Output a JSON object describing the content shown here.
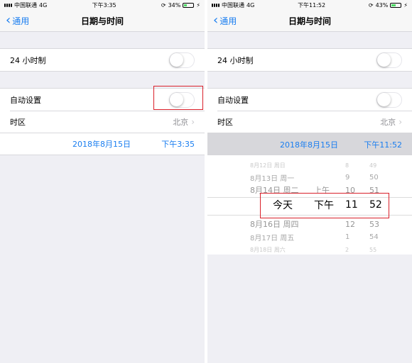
{
  "left": {
    "status": {
      "carrier": "中国联通",
      "network": "4G",
      "time": "下午3:35",
      "battery": "34%",
      "battery_level": 0.34
    },
    "nav": {
      "back_label": "通用",
      "title": "日期与时间"
    },
    "rows": {
      "h24_label": "24 小时制",
      "auto_label": "自动设置",
      "timezone_label": "时区",
      "timezone_value": "北京"
    },
    "datetime": {
      "date": "2018年8月15日",
      "time": "下午3:35"
    }
  },
  "right": {
    "status": {
      "carrier": "中国联通",
      "network": "4G",
      "time": "下午11:52",
      "battery": "43%",
      "battery_level": 0.43
    },
    "nav": {
      "back_label": "通用",
      "title": "日期与时间"
    },
    "rows": {
      "h24_label": "24 小时制",
      "auto_label": "自动设置",
      "timezone_label": "时区",
      "timezone_value": "北京"
    },
    "datetime": {
      "date": "2018年8月15日",
      "time": "下午11:52"
    },
    "picker": {
      "rows": [
        {
          "date": "8月12日 周日",
          "ampm": "",
          "hour": "8",
          "minute": "49"
        },
        {
          "date": "8月13日 周一",
          "ampm": "",
          "hour": "9",
          "minute": "50"
        },
        {
          "date": "8月14日 周二",
          "ampm": "上午",
          "hour": "10",
          "minute": "51"
        },
        {
          "date": "今天",
          "ampm": "下午",
          "hour": "11",
          "minute": "52"
        },
        {
          "date": "8月16日 周四",
          "ampm": "",
          "hour": "12",
          "minute": "53"
        },
        {
          "date": "8月17日 周五",
          "ampm": "",
          "hour": "1",
          "minute": "54"
        },
        {
          "date": "8月18日 周六",
          "ampm": "",
          "hour": "2",
          "minute": "55"
        }
      ]
    }
  },
  "colors": {
    "accent": "#1a7ef0",
    "highlight": "#d9202a",
    "background": "#efeff4"
  },
  "icons": {
    "back": "chevron-left-icon",
    "disclosure": "chevron-right-icon",
    "orientation": "lock-rotation-icon",
    "charging": "bolt-icon"
  }
}
